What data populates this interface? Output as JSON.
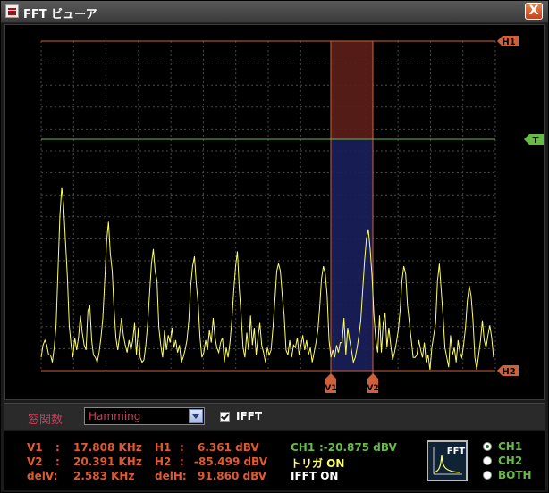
{
  "window": {
    "title": "FFT ビューア",
    "close_label": "X"
  },
  "scope": {
    "markers": {
      "h1": "H1",
      "h2": "H2",
      "t": "T",
      "v1": "V1",
      "v2": "V2"
    },
    "trace": [
      0.05,
      0.1,
      0.12,
      0.1,
      0.06,
      0.06,
      0.03,
      0.09,
      0.18,
      0.4,
      0.62,
      0.74,
      0.67,
      0.52,
      0.38,
      0.18,
      0.1,
      0.05,
      0.13,
      0.08,
      0.13,
      0.22,
      0.15,
      0.1,
      0.08,
      0.24,
      0.26,
      0.12,
      0.06,
      0.05,
      0.03,
      0.07,
      0.13,
      0.21,
      0.36,
      0.52,
      0.6,
      0.47,
      0.4,
      0.25,
      0.13,
      0.08,
      0.14,
      0.21,
      0.14,
      0.1,
      0.07,
      0.12,
      0.08,
      0.12,
      0.19,
      0.06,
      0.17,
      0.05,
      0.03,
      0.04,
      0.1,
      0.19,
      0.31,
      0.43,
      0.49,
      0.4,
      0.36,
      0.17,
      0.1,
      0.05,
      0.16,
      0.08,
      0.14,
      0.11,
      0.17,
      0.09,
      0.12,
      0.07,
      0.1,
      0.03,
      0.05,
      0.08,
      0.12,
      0.2,
      0.34,
      0.42,
      0.46,
      0.35,
      0.27,
      0.13,
      0.05,
      0.07,
      0.12,
      0.08,
      0.16,
      0.11,
      0.21,
      0.13,
      0.09,
      0.07,
      0.11,
      0.13,
      0.03,
      0.09,
      0.05,
      0.11,
      0.2,
      0.32,
      0.42,
      0.48,
      0.33,
      0.22,
      0.09,
      0.05,
      0.15,
      0.08,
      0.22,
      0.1,
      0.17,
      0.06,
      0.13,
      0.19,
      0.1,
      0.07,
      0.03,
      0.09,
      0.06,
      0.08,
      0.17,
      0.28,
      0.4,
      0.43,
      0.4,
      0.3,
      0.22,
      0.08,
      0.06,
      0.12,
      0.05,
      0.1,
      0.09,
      0.13,
      0.06,
      0.1,
      0.14,
      0.08,
      0.12,
      0.06,
      0.09,
      0.03,
      0.07,
      0.11,
      0.16,
      0.25,
      0.37,
      0.42,
      0.39,
      0.3,
      0.12,
      0.05,
      0.08,
      0.05,
      0.1,
      0.07,
      0.11,
      0.11,
      0.21,
      0.06,
      0.17,
      0.12,
      0.08,
      0.03,
      0.05,
      0.09,
      0.14,
      0.2,
      0.32,
      0.44,
      0.53,
      0.57,
      0.49,
      0.38,
      0.22,
      0.12,
      0.07,
      0.22,
      0.07,
      0.19,
      0.23,
      0.09,
      0.17,
      0.1,
      0.04,
      0.07,
      0.11,
      0.16,
      0.24,
      0.36,
      0.42,
      0.39,
      0.26,
      0.19,
      0.12,
      0.05,
      0.05,
      0.06,
      0.12,
      0.08,
      0.05,
      0.11,
      0.03,
      0.06,
      0.0,
      0.09,
      0.14,
      0.19,
      0.36,
      0.43,
      0.32,
      0.22,
      0.09,
      0.05,
      0.01,
      0.14,
      0.06,
      0.09,
      0.03,
      0.12,
      0.07,
      0.05,
      0.1,
      0.17,
      0.28,
      0.34,
      0.3,
      0.2,
      0.05,
      0.0,
      0.06,
      0.12,
      0.2,
      0.12,
      0.09,
      0.14,
      0.18,
      0.13,
      0.05
    ]
  },
  "controls": {
    "window_func_label": "窓関数",
    "window_func_value": "Hamming",
    "ifft_label": "IFFT"
  },
  "readout": {
    "v1_label": "V1",
    "v1_sep": ":",
    "v1_value": "17.808 KHz",
    "v2_label": "V2",
    "v2_sep": ":",
    "v2_value": "20.391 KHz",
    "delv_label": "delV:",
    "delv_value": "2.583 KHz",
    "h1_label": "H1",
    "h1_sep": ":",
    "h1_value": "6.361 dBV",
    "h2_label": "H2",
    "h2_sep": ":",
    "h2_value": "-85.499 dBV",
    "delh_label": "delH:",
    "delh_value": "91.860 dBV",
    "ch1_label": "CH1",
    "ch1_value": ":-20.875 dBV",
    "trigger_label": "トリガ ON",
    "ifft_status": "IFFT ON",
    "fft_button_label": "FFT",
    "channels": [
      "CH1",
      "CH2",
      "BOTH"
    ],
    "colors": {
      "orange": "#e05a30",
      "green": "#66bb44",
      "yellow": "#ffff66",
      "trace": "#ffff66"
    }
  }
}
